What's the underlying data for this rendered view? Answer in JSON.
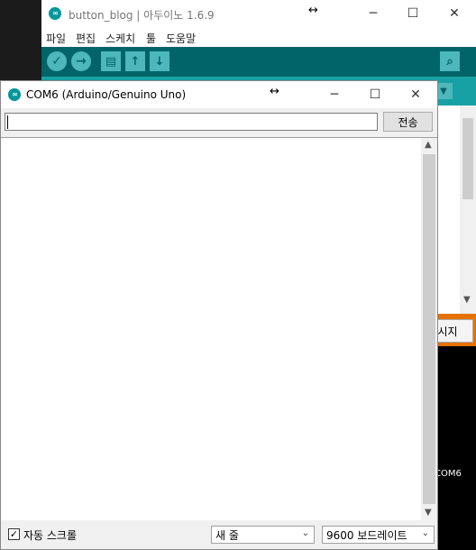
{
  "ide": {
    "title": "button_blog | 아두이노 1.6.9",
    "logo_glyph": "∞",
    "menu": [
      "파일",
      "편집",
      "스케치",
      "툴",
      "도움말"
    ],
    "toolbar_icons": [
      "verify-icon",
      "upload-icon",
      "new-icon",
      "open-icon",
      "save-icon",
      "serial-monitor-icon"
    ],
    "serial_button_label": "시지",
    "status_port": "COM6",
    "accent_color": "#00979c",
    "console_border_color": "#e47200"
  },
  "monitor": {
    "title": "COM6 (Arduino/Genuino Uno)",
    "input_value": "",
    "send_label": "전송",
    "autoscroll_label": "자동 스크롤",
    "autoscroll_checked": true,
    "checkmark": "✓",
    "line_ending": "새 줄",
    "baud_rate": "9600 보드레이트"
  },
  "window_controls": {
    "resize": "↔",
    "minimize": "─",
    "maximize": "☐",
    "close": "✕",
    "scroll_up": "▲",
    "scroll_down": "▼",
    "dropdown": "⌄"
  }
}
